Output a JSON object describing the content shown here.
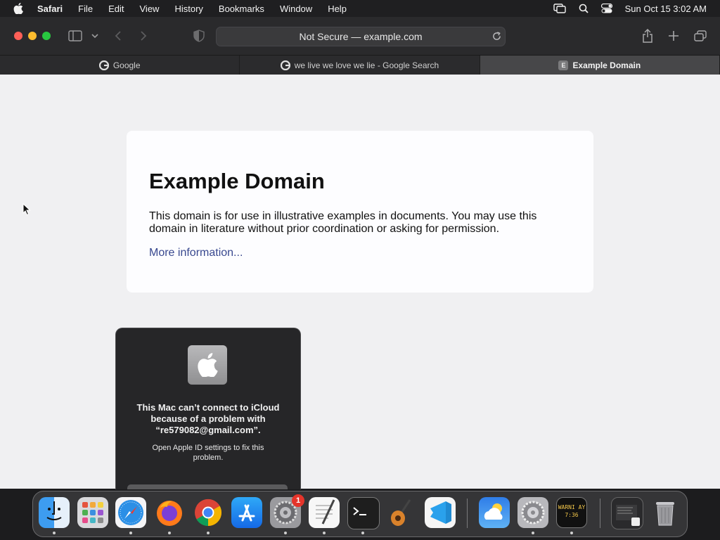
{
  "menubar": {
    "app": "Safari",
    "items": [
      "File",
      "Edit",
      "View",
      "History",
      "Bookmarks",
      "Window",
      "Help"
    ],
    "clock": "Sun Oct 15  3:02 AM",
    "status_icons": [
      "screen-mirroring-icon",
      "spotlight-search-icon",
      "control-center-icon"
    ]
  },
  "toolbar": {
    "address": "Not Secure — example.com"
  },
  "tabs": [
    {
      "label": "Google",
      "favicon": "google-icon"
    },
    {
      "label": "we live we love we lie - Google Search",
      "favicon": "google-icon"
    },
    {
      "label": "Example Domain",
      "favicon": "E",
      "active": true
    }
  ],
  "page": {
    "heading": "Example Domain",
    "body": "This domain is for use in illustrative examples in documents. You may use this domain in literature without prior coordination or asking for permission.",
    "link": "More information..."
  },
  "alert": {
    "title": "This Mac can’t connect to iCloud because of a problem with “re579082@gmail.com”.",
    "message": "Open Apple ID settings to fix this problem."
  },
  "dock": {
    "apps": [
      "Finder",
      "Launchpad",
      "Safari",
      "Firefox",
      "Google Chrome",
      "App Store",
      "System Preferences",
      "TextEdit",
      "Terminal",
      "GarageBand",
      "Visual Studio Code",
      "Weather",
      "System Preferences",
      "Console"
    ],
    "system_prefs_badge": "1",
    "console_text": "WARNI AY 7:36"
  },
  "colors": {
    "link": "#38488f",
    "close": "#ff5f57",
    "minimize": "#febc2e",
    "zoom": "#28c840"
  }
}
